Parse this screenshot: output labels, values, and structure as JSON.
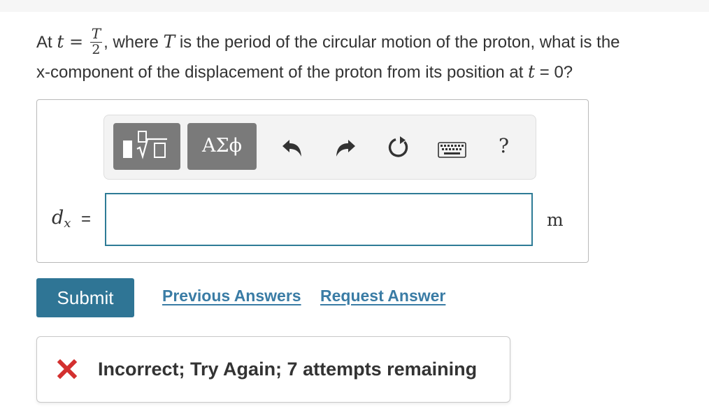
{
  "question": {
    "p1": "At ",
    "t": "t",
    "eq": " = ",
    "frac_num": "T",
    "frac_den": "2",
    "p2": ", where ",
    "T": "T",
    "p3": " is the period of the circular motion of the proton, what is the",
    "line2": "x-component of the displacement of the proton from its position at ",
    "t2": "t",
    "p4": " = 0?"
  },
  "toolbar": {
    "symbols_label": "ΑΣϕ",
    "help_label": "?",
    "icons": [
      "templates-icon",
      "undo-icon",
      "redo-icon",
      "reset-icon",
      "keyboard-icon",
      "help-icon"
    ]
  },
  "answer": {
    "var": "d",
    "sub": "x",
    "equals": "=",
    "value": "",
    "unit": "m"
  },
  "actions": {
    "submit": "Submit",
    "previous_answers": "Previous Answers",
    "request_answer": "Request Answer"
  },
  "feedback": {
    "text": "Incorrect; Try Again; 7 attempts remaining"
  },
  "colors": {
    "accent": "#2f7595",
    "link": "#3a7ca5",
    "error": "#d3302f"
  }
}
